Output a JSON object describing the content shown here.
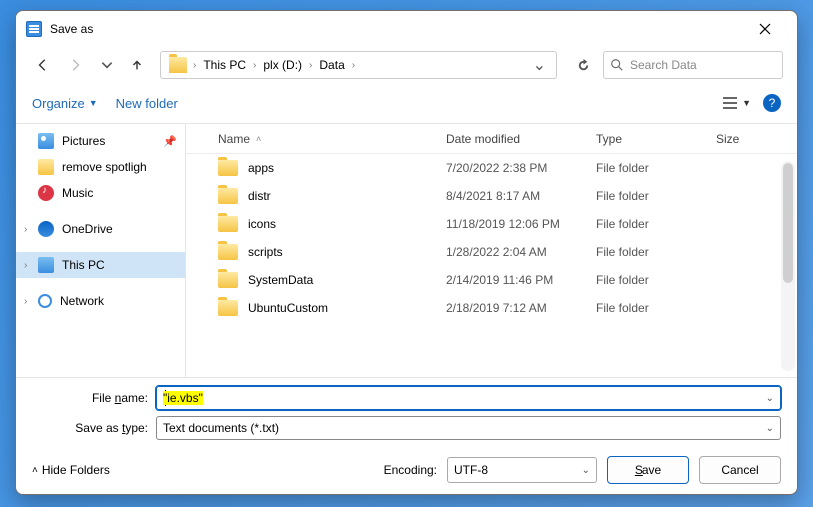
{
  "title": "Save as",
  "breadcrumb": [
    "This PC",
    "plx (D:)",
    "Data"
  ],
  "search": {
    "placeholder": "Search Data"
  },
  "toolbar": {
    "organize": "Organize",
    "newfolder": "New folder"
  },
  "sidebar": {
    "quick": [
      {
        "label": "Pictures",
        "icon": "pic",
        "pinned": true
      },
      {
        "label": "remove spotligh",
        "icon": "folder"
      },
      {
        "label": "Music",
        "icon": "music"
      }
    ],
    "roots": [
      {
        "label": "OneDrive",
        "icon": "od"
      },
      {
        "label": "This PC",
        "icon": "pc",
        "active": true
      },
      {
        "label": "Network",
        "icon": "net"
      }
    ]
  },
  "columns": {
    "name": "Name",
    "date": "Date modified",
    "type": "Type",
    "size": "Size"
  },
  "files": [
    {
      "name": "apps",
      "date": "7/20/2022 2:38 PM",
      "type": "File folder"
    },
    {
      "name": "distr",
      "date": "8/4/2021 8:17 AM",
      "type": "File folder"
    },
    {
      "name": "icons",
      "date": "11/18/2019 12:06 PM",
      "type": "File folder"
    },
    {
      "name": "scripts",
      "date": "1/28/2022 2:04 AM",
      "type": "File folder"
    },
    {
      "name": "SystemData",
      "date": "2/14/2019 11:46 PM",
      "type": "File folder"
    },
    {
      "name": "UbuntuCustom",
      "date": "2/18/2019 7:12 AM",
      "type": "File folder"
    }
  ],
  "fields": {
    "filename_label": "File name:",
    "filename_value": "\"ie.vbs\"",
    "saveas_label": "Save as type:",
    "saveas_value": "Text documents (*.txt)"
  },
  "footer": {
    "hide": "Hide Folders",
    "encoding_label": "Encoding:",
    "encoding_value": "UTF-8",
    "save": "Save",
    "cancel": "Cancel"
  }
}
